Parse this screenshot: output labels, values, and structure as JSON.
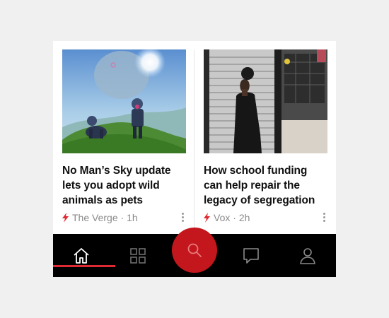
{
  "articles": [
    {
      "title": "No Man’s Sky update lets you adopt wild animals as pets",
      "source": "The Verge",
      "time": "1h",
      "image": "game-scene-image"
    },
    {
      "title": "How school funding can help repair the legacy of segregation",
      "source": "Vox",
      "time": "2h",
      "image": "student-street-photo"
    }
  ],
  "meta_separator": " · ",
  "nav": {
    "items": [
      {
        "name": "home",
        "icon": "home-icon",
        "active": true
      },
      {
        "name": "sections",
        "icon": "grid-icon",
        "active": false
      },
      {
        "name": "search",
        "icon": "search-icon",
        "active": false
      },
      {
        "name": "messages",
        "icon": "chat-icon",
        "active": false
      },
      {
        "name": "profile",
        "icon": "user-icon",
        "active": false
      }
    ]
  },
  "colors": {
    "accent": "#e02a33",
    "search_fab": "#c4171d",
    "nav_bg": "#000000",
    "meta_text": "#8a8a8a"
  }
}
